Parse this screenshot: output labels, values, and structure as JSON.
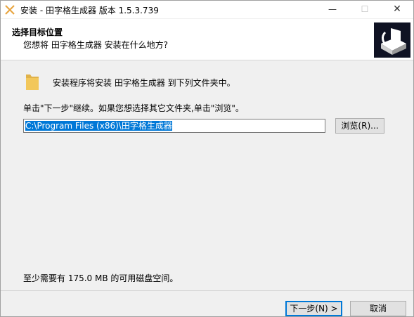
{
  "window": {
    "title": "安装 - 田字格生成器 版本 1.5.3.739",
    "minimize_glyph": "—",
    "maximize_glyph": "☐",
    "close_glyph": "✕"
  },
  "header": {
    "title": "选择目标位置",
    "subtitle": "您想将 田字格生成器 安装在什么地方?"
  },
  "body": {
    "install_to_text": "安装程序将安装 田字格生成器 到下列文件夹中。",
    "instruction_text": "单击\"下一步\"继续。如果您想选择其它文件夹,单击\"浏览\"。",
    "path_value": "C:\\Program Files (x86)\\田字格生成器",
    "browse_label": "浏览(R)...",
    "disk_space_text": "至少需要有 175.0 MB 的可用磁盘空间。"
  },
  "footer": {
    "next_label": "下一步(N) >",
    "cancel_label": "取消"
  },
  "colors": {
    "accent": "#0078d7",
    "logo_bg": "#0f1223",
    "folder": "#f2c75b"
  },
  "icons": {
    "app": "setup-icon",
    "logo": "installer-logo-icon",
    "folder": "folder-icon"
  }
}
